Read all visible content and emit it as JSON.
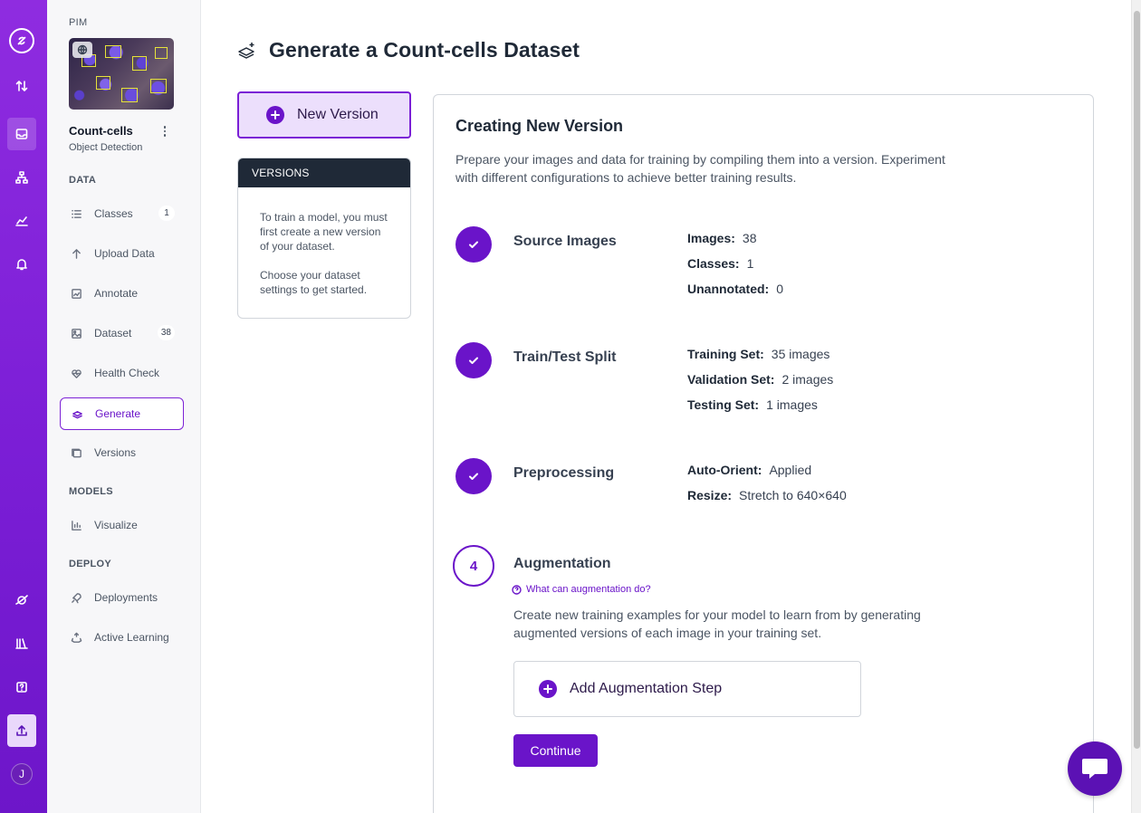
{
  "rail": {
    "avatar_initial": "J"
  },
  "sidebar": {
    "workspace": "PIM",
    "project_name": "Count-cells",
    "project_type": "Object Detection",
    "section_data": "DATA",
    "section_models": "MODELS",
    "section_deploy": "DEPLOY",
    "items": {
      "classes": {
        "label": "Classes",
        "badge": "1"
      },
      "upload": {
        "label": "Upload Data"
      },
      "annotate": {
        "label": "Annotate"
      },
      "dataset": {
        "label": "Dataset",
        "badge": "38"
      },
      "health": {
        "label": "Health Check"
      },
      "generate": {
        "label": "Generate"
      },
      "versions": {
        "label": "Versions"
      },
      "visualize": {
        "label": "Visualize"
      },
      "deployments": {
        "label": "Deployments"
      },
      "active_learning": {
        "label": "Active Learning"
      }
    }
  },
  "header": {
    "title": "Generate a Count-cells Dataset"
  },
  "new_version_label": "New Version",
  "versions_panel": {
    "heading": "VERSIONS",
    "text1": "To train a model, you must first create a new version of your dataset.",
    "text2": "Choose your dataset settings to get started."
  },
  "creator": {
    "title": "Creating New Version",
    "description": "Prepare your images and data for training by compiling them into a version. Experiment with different configurations to achieve better training results.",
    "source": {
      "title": "Source Images",
      "images_k": "Images:",
      "images_v": "38",
      "classes_k": "Classes:",
      "classes_v": "1",
      "unannotated_k": "Unannotated:",
      "unannotated_v": "0"
    },
    "split": {
      "title": "Train/Test Split",
      "train_k": "Training Set:",
      "train_v": "35 images",
      "valid_k": "Validation Set:",
      "valid_v": "2 images",
      "test_k": "Testing Set:",
      "test_v": "1 images"
    },
    "preprocessing": {
      "title": "Preprocessing",
      "orient_k": "Auto-Orient:",
      "orient_v": "Applied",
      "resize_k": "Resize:",
      "resize_v": "Stretch to 640×640"
    },
    "augmentation": {
      "step_number": "4",
      "title": "Augmentation",
      "help_link": "What can augmentation do?",
      "description": "Create new training examples for your model to learn from by generating augmented versions of each image in your training set.",
      "add_label": "Add Augmentation Step",
      "continue_label": "Continue"
    }
  },
  "colors": {
    "brand_purple": "#6a14c9",
    "rail_gradient_top": "#8f2ce0",
    "active_tint": "#ecdffc"
  }
}
